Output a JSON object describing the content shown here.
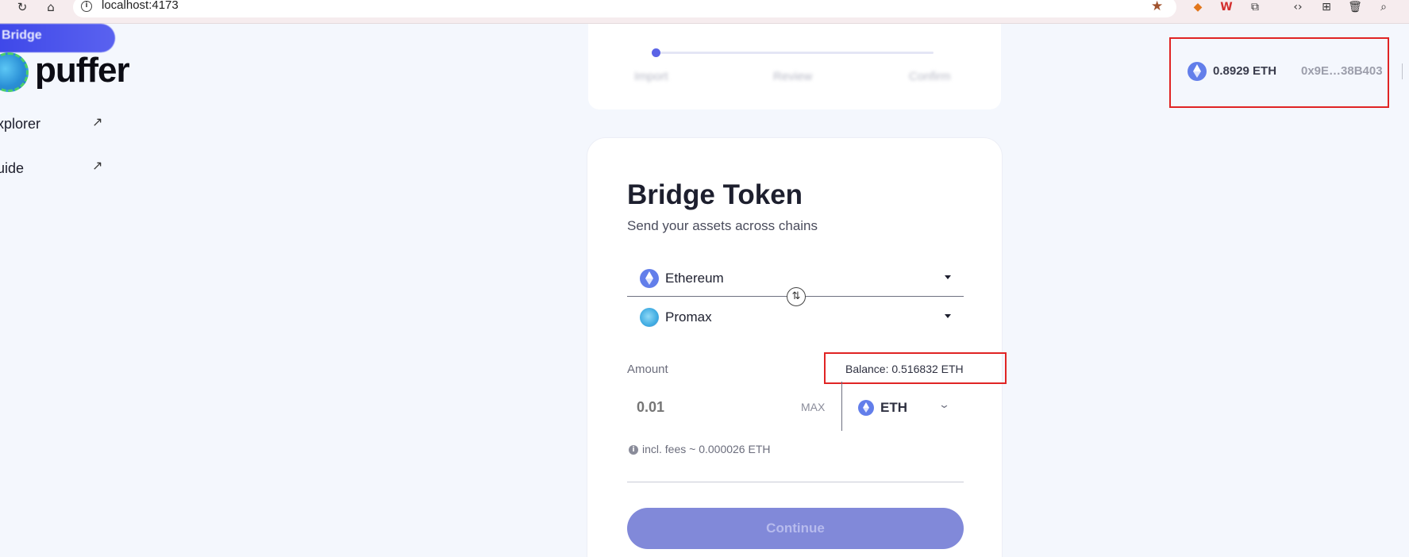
{
  "browser": {
    "url": "localhost:4173"
  },
  "sidebar": {
    "active_item": "Bridge",
    "brand": "puffer",
    "links": [
      {
        "label": "xplorer"
      },
      {
        "label": "uide"
      }
    ]
  },
  "stepper": {
    "steps": [
      "Import",
      "Review",
      "Confirm"
    ]
  },
  "card": {
    "title": "Bridge Token",
    "subtitle": "Send your assets across chains",
    "from_chain": "Ethereum",
    "to_chain": "Promax",
    "amount_label": "Amount",
    "balance": "Balance: 0.516832 ETH",
    "amount_placeholder": "0.01",
    "max_label": "MAX",
    "token": "ETH",
    "fee_text": "incl. fees ~ 0.000026 ETH",
    "continue_label": "Continue"
  },
  "wallet": {
    "balance": "0.8929 ETH",
    "address": "0x9E…38B403"
  },
  "colors": {
    "accent": "#5b64e6",
    "button_disabled": "#8189d9",
    "eth": "#627eea",
    "highlight": "#e02424",
    "background": "#f4f7fd"
  }
}
